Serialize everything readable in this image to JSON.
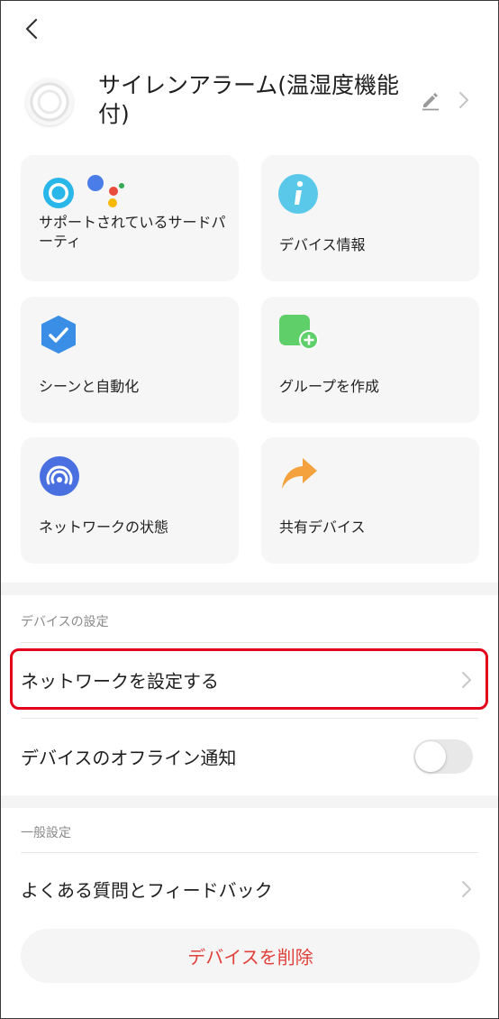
{
  "header": {
    "device_title": "サイレンアラーム(温湿度機能付)"
  },
  "cards": [
    {
      "label": "サポートされているサードパーティ",
      "icon": "alexa-google-icon"
    },
    {
      "label": "デバイス情報",
      "icon": "info-icon"
    },
    {
      "label": "シーンと自動化",
      "icon": "automation-check-icon"
    },
    {
      "label": "グループを作成",
      "icon": "add-group-icon"
    },
    {
      "label": "ネットワークの状態",
      "icon": "network-signal-icon"
    },
    {
      "label": "共有デバイス",
      "icon": "share-arrow-icon"
    }
  ],
  "device_settings": {
    "header": "デバイスの設定",
    "network_setup": "ネットワークを設定する",
    "offline_notify": "デバイスのオフライン通知",
    "offline_notify_enabled": false
  },
  "general_settings": {
    "header": "一般設定",
    "faq": "よくある質問とフィードバック"
  },
  "delete_button": "デバイスを削除",
  "colors": {
    "highlight": "#e3001b",
    "delete_text": "#e0403a",
    "info_icon": "#5ac8e8",
    "automation_icon": "#3a8ee6",
    "group_icon": "#5fcf6a",
    "network_icon": "#4a6fe0",
    "share_icon": "#f3a23d"
  }
}
